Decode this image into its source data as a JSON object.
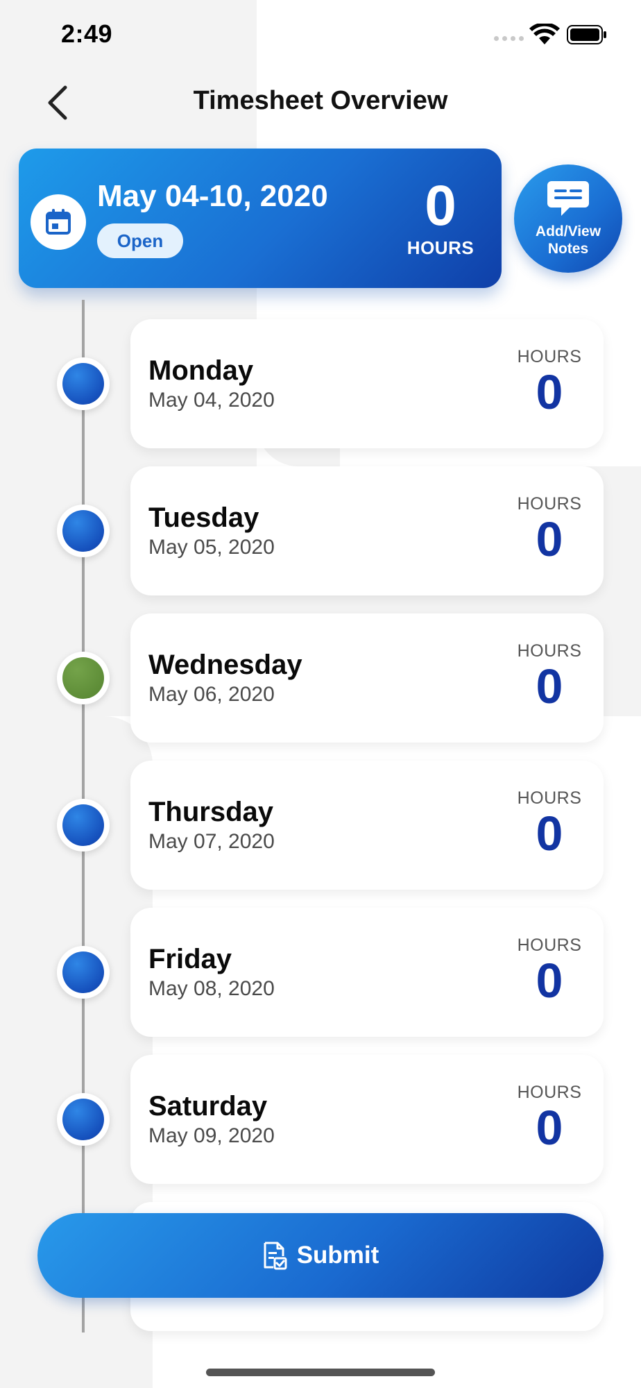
{
  "status_bar": {
    "time": "2:49"
  },
  "header": {
    "title": "Timesheet Overview"
  },
  "week": {
    "range": "May 04-10, 2020",
    "status": "Open",
    "total_hours": "0",
    "hours_label": "HOURS"
  },
  "notes_button": {
    "label_line1": "Add/View",
    "label_line2": "Notes"
  },
  "days": [
    {
      "name": "Monday",
      "date": "May 04, 2020",
      "hours_label": "HOURS",
      "hours": "0",
      "dot_color": "#1651bd"
    },
    {
      "name": "Tuesday",
      "date": "May 05, 2020",
      "hours_label": "HOURS",
      "hours": "0",
      "dot_color": "#1651bd"
    },
    {
      "name": "Wednesday",
      "date": "May 06, 2020",
      "hours_label": "HOURS",
      "hours": "0",
      "dot_color": "#5b8a35"
    },
    {
      "name": "Thursday",
      "date": "May 07, 2020",
      "hours_label": "HOURS",
      "hours": "0",
      "dot_color": "#1651bd"
    },
    {
      "name": "Friday",
      "date": "May 08, 2020",
      "hours_label": "HOURS",
      "hours": "0",
      "dot_color": "#1651bd"
    },
    {
      "name": "Saturday",
      "date": "May 09, 2020",
      "hours_label": "HOURS",
      "hours": "0",
      "dot_color": "#1651bd"
    }
  ],
  "submit": {
    "label": "Submit"
  },
  "colors": {
    "accent_blue": "#1a6fd3",
    "accent_dark_blue": "#0f3fa8",
    "hours_value": "#1234a2",
    "today_green": "#5b8a35"
  }
}
